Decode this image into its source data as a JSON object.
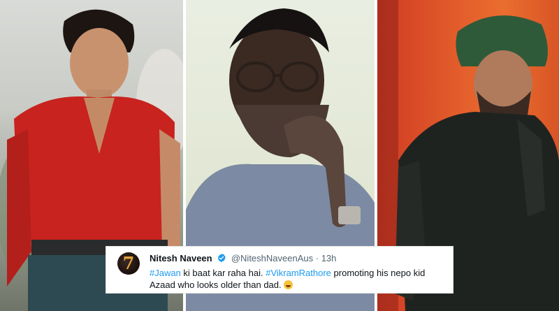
{
  "tweet": {
    "avatar_text": "7",
    "author_name": "Nitesh Naveen",
    "handle": "@NiteshNaveenAus",
    "separator": "·",
    "time": "13h",
    "hashtag1": "#Jawan",
    "text1": " ki baat kar raha hai. ",
    "hashtag2": "#VikramRathore",
    "text2": " promoting his nepo kid Azaad who looks older than dad. ",
    "emoji_name": "rolling-on-floor-laughing",
    "link_color": "#1d9bf0",
    "verified_color": "#1d9bf0"
  },
  "colors": {
    "panel_left_shirt": "#c8231e",
    "panel_right_turban": "#2f5a3a"
  }
}
